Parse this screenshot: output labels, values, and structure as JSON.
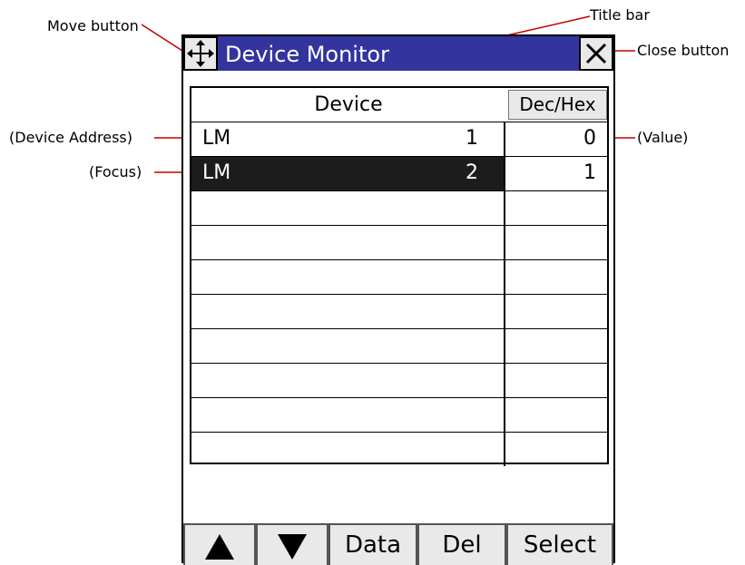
{
  "window": {
    "title": "Device Monitor",
    "move_icon": "move-arrows-icon",
    "close_icon": "close-x-icon",
    "title_bar_color": "#34349e"
  },
  "grid": {
    "header_device": "Device",
    "header_dechex": "Dec/Hex",
    "rows": [
      {
        "device": "LM",
        "number": "1",
        "value": "0",
        "focused": false
      },
      {
        "device": "LM",
        "number": "2",
        "value": "1",
        "focused": true
      }
    ],
    "total_rows": 10
  },
  "toolbar": {
    "up_icon": "up-triangle-icon",
    "down_icon": "down-triangle-icon",
    "data_label": "Data",
    "del_label": "Del",
    "select_label": "Select"
  },
  "annotations": {
    "move_button": "Move button",
    "title_bar": "Title bar",
    "close_button": "Close button",
    "device_address": "(Device Address)",
    "value": "(Value)",
    "focus": "(Focus)"
  }
}
